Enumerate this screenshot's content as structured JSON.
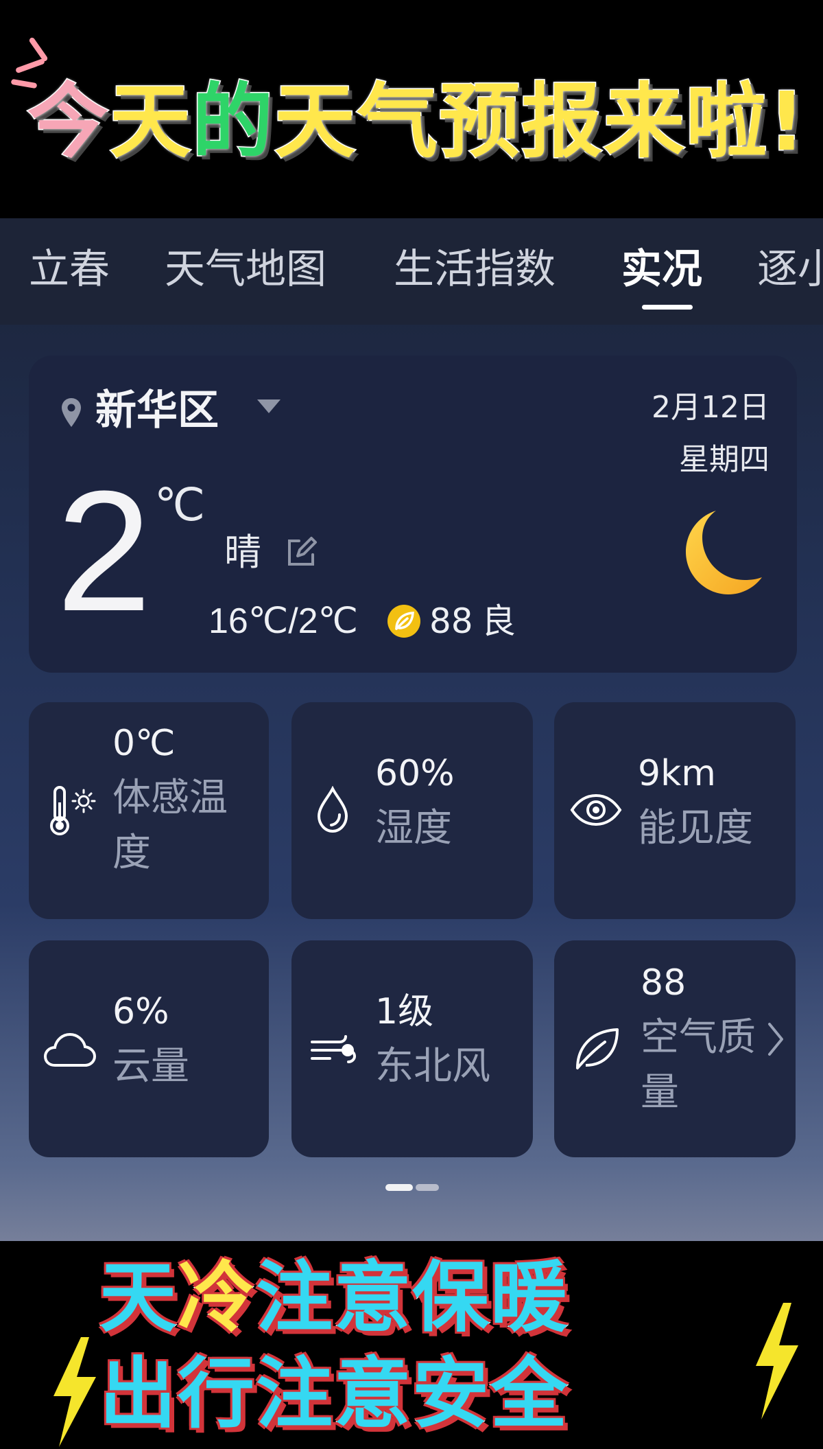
{
  "banner_top": {
    "headline": [
      {
        "char": "今",
        "color": "#f6a6b6"
      },
      {
        "char": "天",
        "color": "#ffe74c"
      },
      {
        "char": "的",
        "color": "#2ed468"
      },
      {
        "char": "天",
        "color": "#ffe74c"
      },
      {
        "char": "气",
        "color": "#ffe74c"
      },
      {
        "char": "预",
        "color": "#ffe74c"
      },
      {
        "char": "报",
        "color": "#ffe74c"
      },
      {
        "char": "来",
        "color": "#ffe74c"
      },
      {
        "char": "啦",
        "color": "#ffe74c"
      },
      {
        "char": "!",
        "color": "#ffe74c"
      }
    ]
  },
  "tabs": [
    {
      "label": "立春",
      "active": false
    },
    {
      "label": "天气地图",
      "active": false
    },
    {
      "label": "生活指数",
      "active": false
    },
    {
      "label": "实况",
      "active": true
    },
    {
      "label": "逐小",
      "active": false
    }
  ],
  "summary": {
    "location": "新华区",
    "date": "2月12日",
    "weekday": "星期四",
    "temperature": "2",
    "unit": "℃",
    "condition": "晴",
    "range": "16℃/2℃",
    "aqi_value": "88",
    "aqi_label": "良",
    "weather_icon": "moon-icon"
  },
  "metrics": [
    {
      "icon": "thermometer-sun-icon",
      "value": "0℃",
      "label": "体感温度"
    },
    {
      "icon": "water-drop-icon",
      "value": "60%",
      "label": "湿度"
    },
    {
      "icon": "eye-icon",
      "value": "9km",
      "label": "能见度"
    },
    {
      "icon": "cloud-icon",
      "value": "6%",
      "label": "云量"
    },
    {
      "icon": "wind-icon",
      "value": "1级",
      "label": "东北风"
    },
    {
      "icon": "leaf-icon",
      "value": "88",
      "label": "空气质量"
    }
  ],
  "pager": {
    "current": 1,
    "total": 2
  },
  "banner_bottom": {
    "line1": [
      {
        "char": "天",
        "color": "#35d8f2"
      },
      {
        "char": "冷",
        "color": "#ffe74c"
      },
      {
        "char": "注",
        "color": "#35d8f2"
      },
      {
        "char": "意",
        "color": "#35d8f2"
      },
      {
        "char": "保",
        "color": "#35d8f2"
      },
      {
        "char": "暖",
        "color": "#35d8f2"
      }
    ],
    "line2": [
      {
        "char": "出",
        "color": "#35d8f2"
      },
      {
        "char": "行",
        "color": "#35d8f2"
      },
      {
        "char": "注",
        "color": "#35d8f2"
      },
      {
        "char": "意",
        "color": "#35d8f2"
      },
      {
        "char": "安",
        "color": "#35d8f2"
      },
      {
        "char": "全",
        "color": "#35d8f2"
      }
    ]
  },
  "colors": {
    "card_bg": "#1f2742",
    "label_gray": "#9aa2b6",
    "moon_yellow": "#f7c02c",
    "bolt_yellow": "#f5e52c"
  }
}
